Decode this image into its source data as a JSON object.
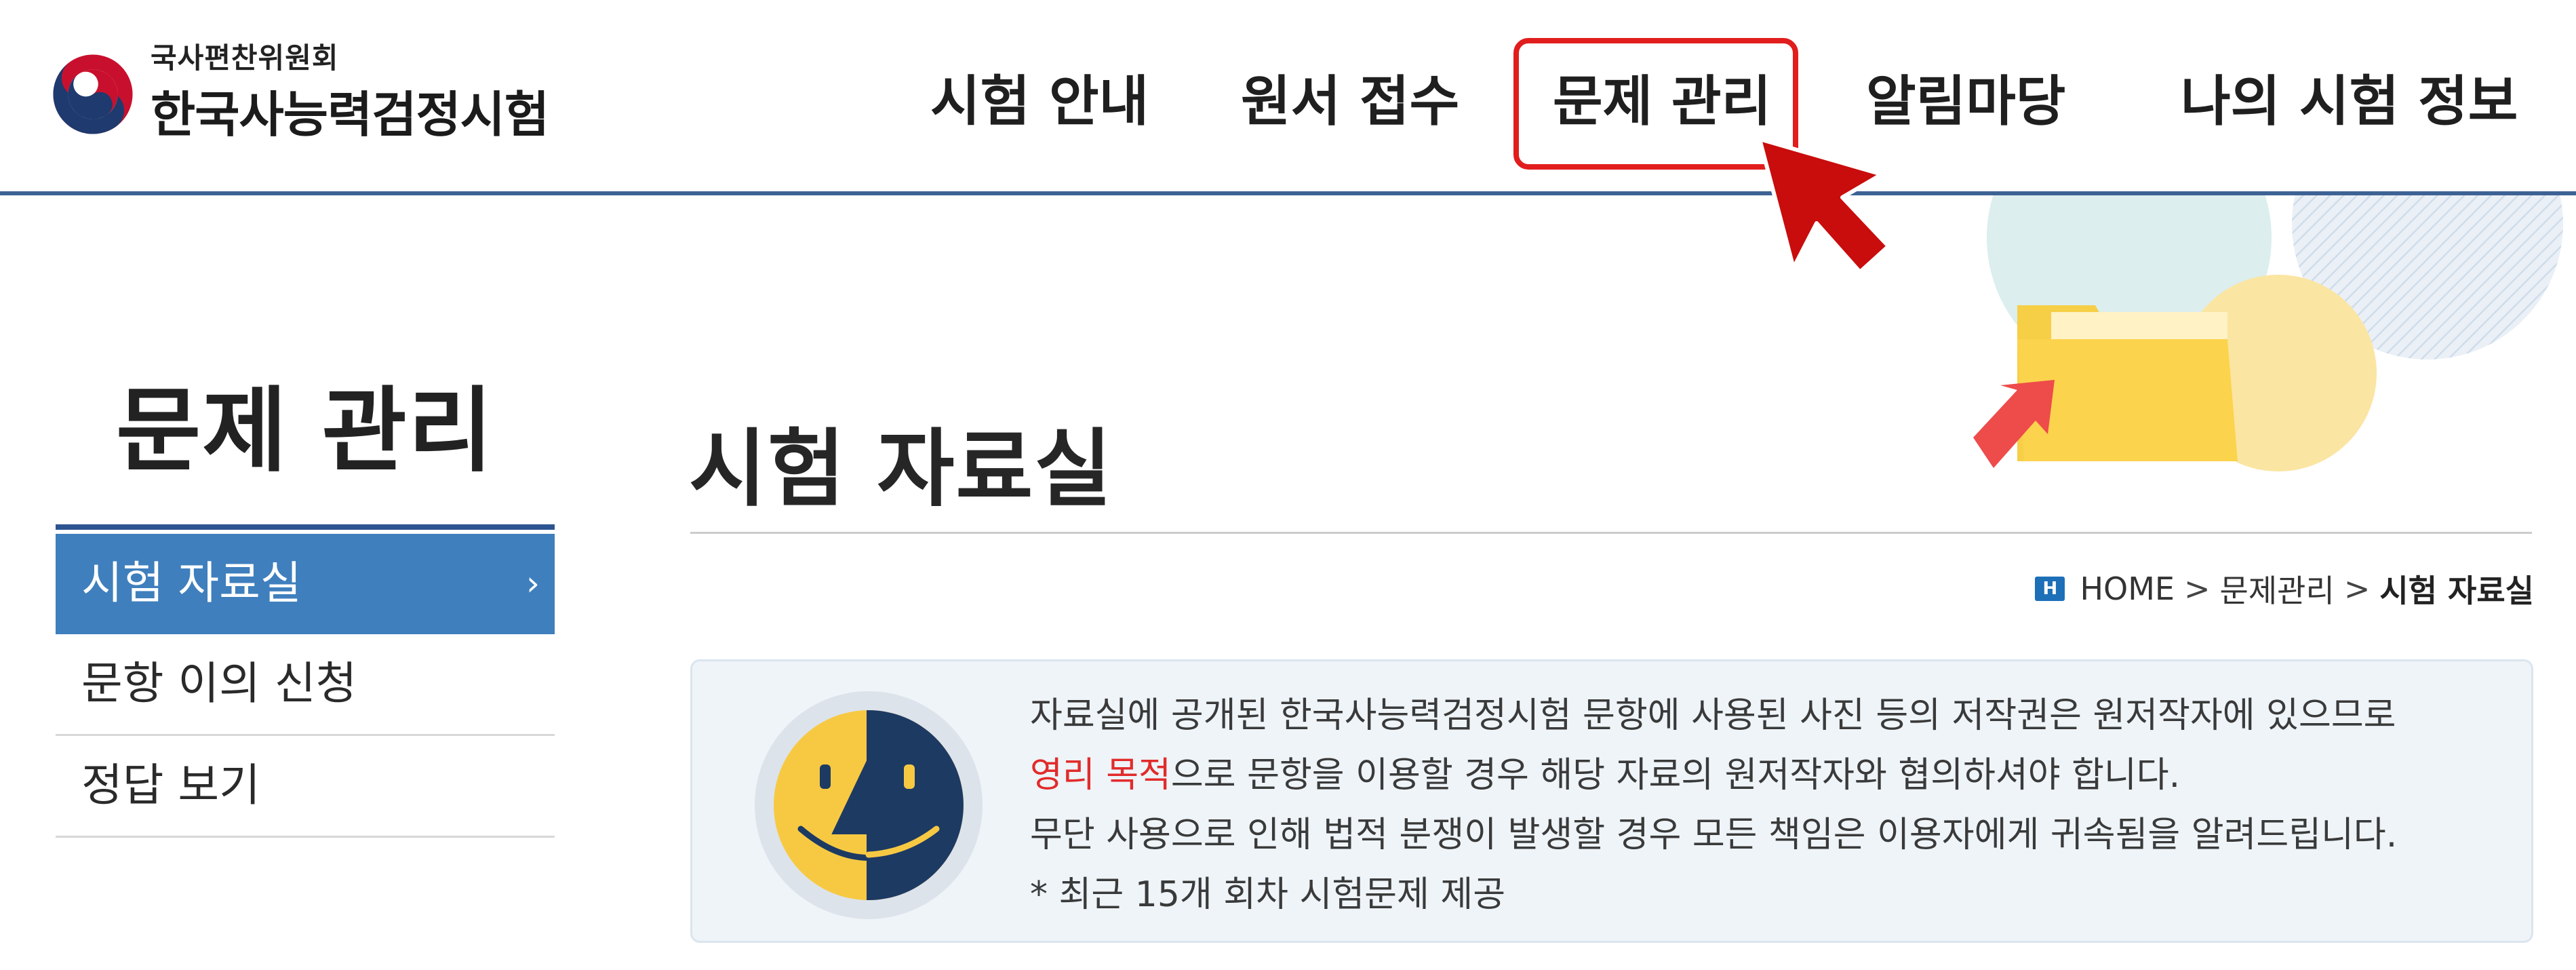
{
  "header": {
    "org_name": "국사편찬위원회",
    "site_name": "한국사능력검정시험",
    "nav": [
      {
        "label": "시험 안내"
      },
      {
        "label": "원서 접수"
      },
      {
        "label": "문제 관리"
      },
      {
        "label": "알림마당"
      },
      {
        "label": "나의 시험 정보"
      }
    ],
    "active_nav_index": 2
  },
  "sidebar": {
    "title": "문제 관리",
    "items": [
      {
        "label": "시험 자료실",
        "active": true,
        "chevron": "›"
      },
      {
        "label": "문항 이의 신청",
        "active": false
      },
      {
        "label": "정답 보기",
        "active": false
      }
    ]
  },
  "main": {
    "title": "시험 자료실",
    "breadcrumb": {
      "home_icon": "H",
      "home": "HOME",
      "separator": ">",
      "section": "문제관리",
      "current": "시험 자료실"
    },
    "notice": {
      "line1": "자료실에 공개된 한국사능력검정시험 문항에 사용된 사진 등의 저작권은 원저작자에 있으므로",
      "line2_highlight": "영리 목적",
      "line2_rest": "으로 문항을 이용할 경우 해당 자료의 원저작자와 협의하셔야 합니다.",
      "line3": "무단 사용으로 인해 법적 분쟁이 발생할 경우 모든 책임은 이용자에게 귀속됨을 알려드립니다.",
      "line4": "* 최근 15개 회차 시험문제 제공"
    }
  },
  "colors": {
    "header_rule": "#3d6294",
    "active_menu_bg": "#3f7fbd",
    "highlight_box": "#e11d1d",
    "notice_bg": "#eef4f8",
    "notice_red": "#e12b2b"
  },
  "icons": {
    "logo": "taeguk-emblem-icon",
    "cursor": "mouse-pointer-icon",
    "folder": "folder-icon",
    "notice": "smiley-face-icon"
  }
}
